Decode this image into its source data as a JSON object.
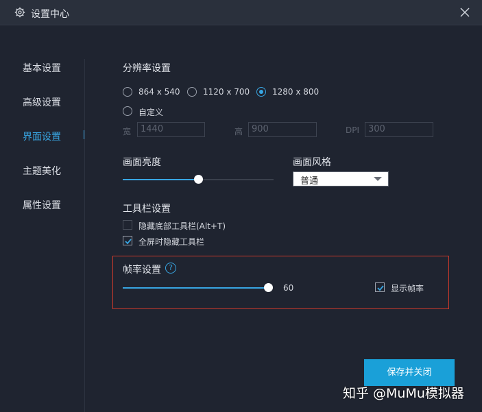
{
  "window": {
    "title": "设置中心"
  },
  "sidebar": {
    "items": [
      {
        "label": "基本设置"
      },
      {
        "label": "高级设置"
      },
      {
        "label": "界面设置"
      },
      {
        "label": "主题美化"
      },
      {
        "label": "属性设置"
      }
    ],
    "active_index": 2
  },
  "resolution": {
    "title": "分辨率设置",
    "options": [
      "864 x 540",
      "1120 x 700",
      "1280 x 800"
    ],
    "custom_label": "自定义",
    "selected": "1280 x 800",
    "width_label": "宽",
    "width_value": "1440",
    "height_label": "高",
    "height_value": "900",
    "dpi_label": "DPI",
    "dpi_value": "300"
  },
  "brightness": {
    "title": "画面亮度",
    "level_fraction": 0.5
  },
  "style": {
    "title": "画面风格",
    "selected": "普通"
  },
  "toolbar": {
    "title": "工具栏设置",
    "hide_bottom_label": "隐藏底部工具栏(Alt+T)",
    "hide_bottom_checked": false,
    "fullscreen_hide_label": "全屏时隐藏工具栏",
    "fullscreen_hide_checked": true
  },
  "framerate": {
    "title": "帧率设置",
    "help_glyph": "?",
    "value": "60",
    "show_fps_label": "显示帧率",
    "show_fps_checked": true
  },
  "actions": {
    "save_close_label": "保存并关闭"
  },
  "watermark": {
    "text": "知乎 @MuMu模拟器"
  },
  "colors": {
    "accent": "#38a6e3",
    "button": "#1aa0d8",
    "highlight_border": "#d03a2b",
    "background": "#1f2430"
  }
}
